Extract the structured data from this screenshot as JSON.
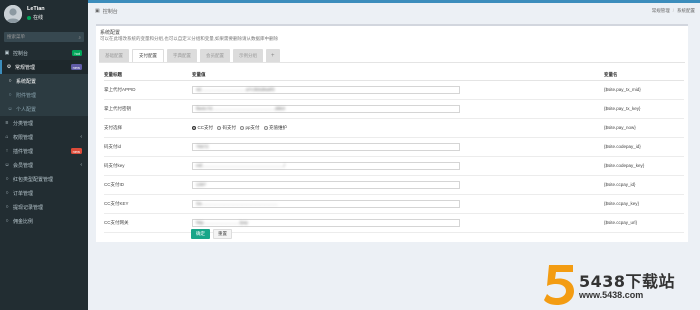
{
  "user": {
    "name": "LeTian",
    "status": "在线"
  },
  "sidebar": {
    "search_placeholder": "搜索菜单",
    "items": [
      {
        "label": "控制台",
        "icon": "dashboard-icon",
        "badge": "hot",
        "badge_color": "#00a65a"
      },
      {
        "label": "常规管理",
        "icon": "gear-icon",
        "badge": "new",
        "badge_color": "#605ca8",
        "active": true
      },
      {
        "label": "系统配置",
        "icon": "circle-icon",
        "sub": true,
        "current": true
      },
      {
        "label": "附件管理",
        "icon": "circle-icon",
        "sub": true
      },
      {
        "label": "个人配置",
        "icon": "user-icon",
        "sub": true
      },
      {
        "label": "分类管理",
        "icon": "list-icon"
      },
      {
        "label": "权限管理",
        "icon": "group-icon",
        "chevron": true
      },
      {
        "label": "插件管理",
        "icon": "rocket-icon",
        "badge": "new",
        "badge_color": "#dd4b39"
      },
      {
        "label": "会员管理",
        "icon": "user-icon",
        "chevron": true
      },
      {
        "label": "红包类型配置管理",
        "icon": "circle-icon"
      },
      {
        "label": "订单管理",
        "icon": "circle-icon"
      },
      {
        "label": "提现记录管理",
        "icon": "circle-icon"
      },
      {
        "label": "佣金比例",
        "icon": "circle-icon"
      }
    ]
  },
  "header": {
    "title": "控制台",
    "breadcrumb": [
      "常规管理",
      "系统配置"
    ]
  },
  "box": {
    "title": "系统配置",
    "desc": "可以在此增改系统的变量和分组,也可以自定义分组和变量,如果需要删除请从数据库中删除"
  },
  "tabs": [
    "基础配置",
    "支付配置",
    "字典配置",
    "会员配置",
    "示例分组",
    "+"
  ],
  "table": {
    "headers": [
      "变量标题",
      "变量值",
      "变量名"
    ],
    "rows": [
      {
        "title": "掌上代付APPID",
        "type": "input",
        "value": "4d…………………………a7c3b5d8a9f3",
        "name": "{$site.pay_tx_mid}"
      },
      {
        "title": "掌上代付密钥",
        "type": "input",
        "value": "f8e6c7d……………………………………d9b3",
        "name": "{$site.pay_tx_key}"
      },
      {
        "title": "支付选择",
        "type": "radio",
        "options": [
          "CC支付",
          "码支付",
          "pp支付",
          "充值维护"
        ],
        "selected": 0,
        "name": "{$site.pay_now}"
      },
      {
        "title": "码支付id",
        "type": "input",
        "value": "76672",
        "name": "{$site.codepay_id}"
      },
      {
        "title": "码支付key",
        "type": "input",
        "value": "mE………………………………………………/",
        "name": "{$site.codepay_key}"
      },
      {
        "title": "CC支付ID",
        "type": "input",
        "value": "1397",
        "name": "{$site.ccpay_id}"
      },
      {
        "title": "CC支付KEY",
        "type": "input",
        "value": "Sa……………………………………………",
        "name": "{$site.ccpay_key}"
      },
      {
        "title": "CC支付网关",
        "type": "input",
        "value": "http……………………/pay",
        "name": "{$site.ccpay_url}"
      }
    ]
  },
  "buttons": {
    "confirm": "确定",
    "reset": "重置"
  },
  "watermark": {
    "number": "5",
    "text": "5438下载站",
    "url": "www.5438.com"
  },
  "colors": {
    "sidebar": "#222d32",
    "accent": "#3c8dbc",
    "confirm": "#18a689",
    "watermark_orange": "#f39c12"
  }
}
